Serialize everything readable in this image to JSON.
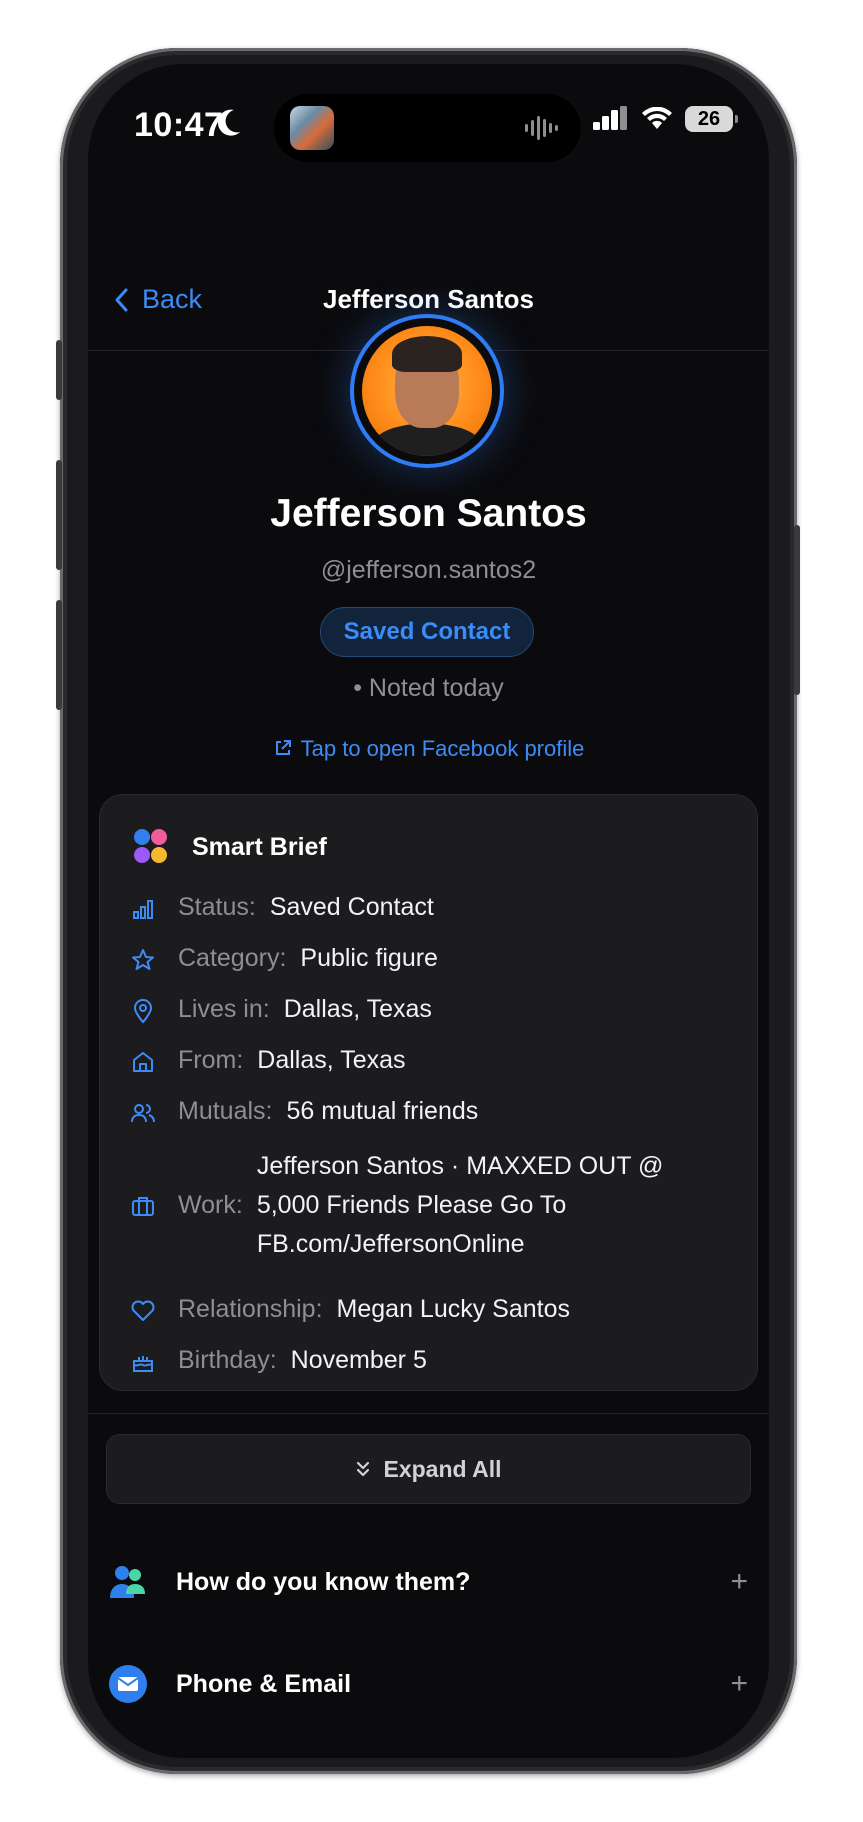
{
  "status_bar": {
    "time": "10:47",
    "battery": "26"
  },
  "nav": {
    "back_label": "Back",
    "title": "Jefferson Santos"
  },
  "profile": {
    "name": "Jefferson Santos",
    "handle": "@jefferson.santos2",
    "badge": "Saved Contact",
    "noted": "• Noted today",
    "facebook_link": "Tap to open Facebook profile"
  },
  "smart_brief": {
    "title": "Smart Brief",
    "rows": [
      {
        "icon": "bar-chart-icon",
        "label": "Status:",
        "value": "Saved Contact"
      },
      {
        "icon": "star-icon",
        "label": "Category:",
        "value": "Public figure"
      },
      {
        "icon": "location-pin-icon",
        "label": "Lives in:",
        "value": "Dallas, Texas"
      },
      {
        "icon": "home-icon",
        "label": "From:",
        "value": "Dallas, Texas"
      },
      {
        "icon": "users-icon",
        "label": "Mutuals:",
        "value": "56 mutual friends"
      },
      {
        "icon": "briefcase-icon",
        "label": "Work:",
        "value": "Jefferson Santos · MAXXED OUT @ 5,000 Friends Please Go To FB.com/JeffersonOnline"
      },
      {
        "icon": "heart-icon",
        "label": "Relationship:",
        "value": "Megan Lucky Santos"
      },
      {
        "icon": "cake-icon",
        "label": "Birthday:",
        "value": "November 5"
      }
    ]
  },
  "expand_all": "Expand All",
  "sections": [
    {
      "title": "How do you know them?",
      "icon": "people-icon",
      "action": "+"
    },
    {
      "title": "Phone & Email",
      "icon": "mail-icon",
      "action": "+"
    }
  ],
  "colors": {
    "accent": "#3b8cf7",
    "background": "#0b0b0d",
    "card": "#1c1c1e"
  }
}
